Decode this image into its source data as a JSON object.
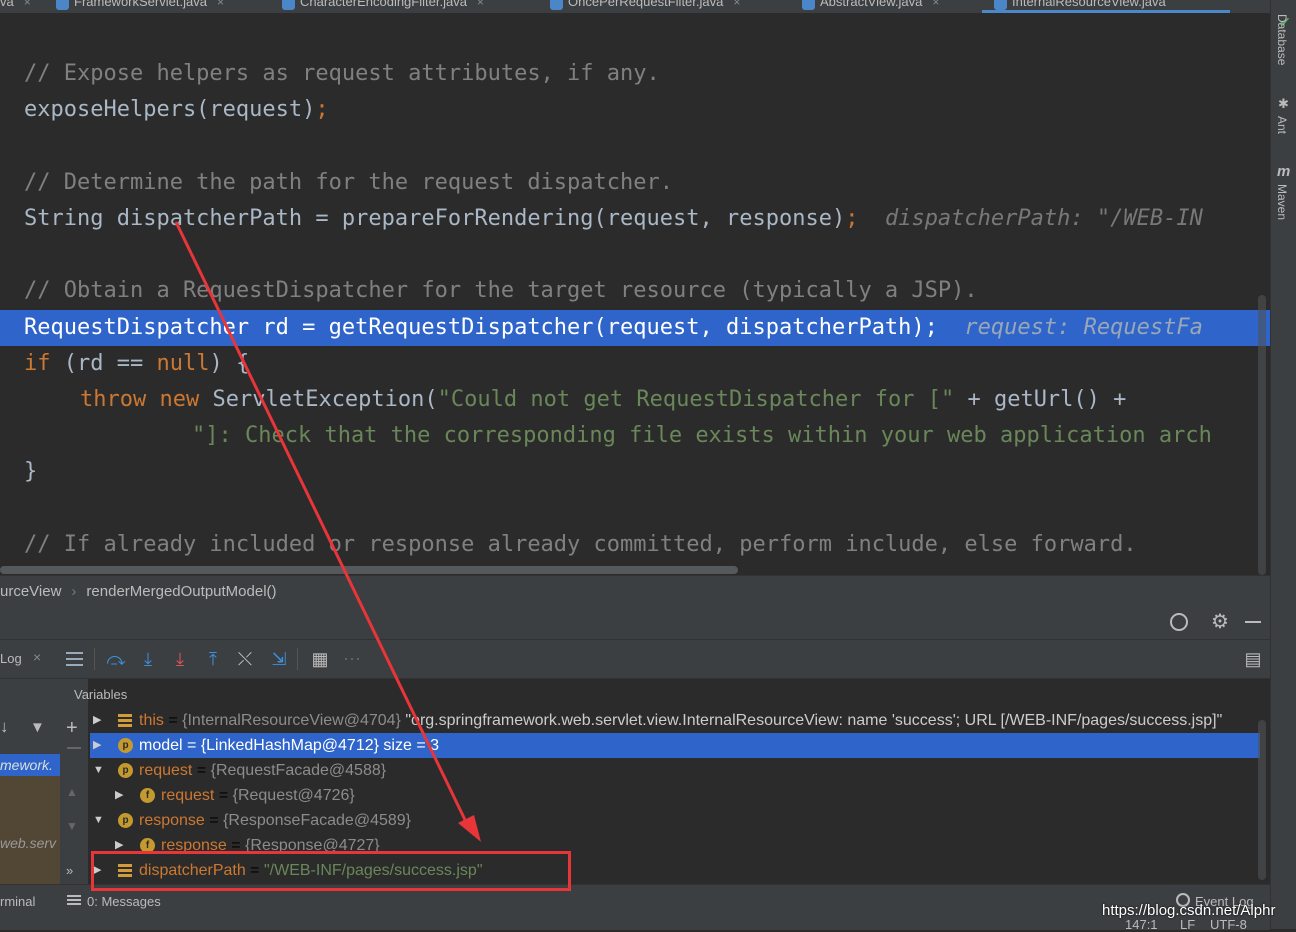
{
  "tabs": [
    {
      "label": "va"
    },
    {
      "label": "FrameworkServlet.java"
    },
    {
      "label": "CharacterEncodingFilter.java"
    },
    {
      "label": "OncePerRequestFilter.java"
    },
    {
      "label": "AbstractView.java"
    },
    {
      "label": "InternalResourceView.java",
      "active": true
    }
  ],
  "right_tools": [
    {
      "label": "Database",
      "icon": "database-icon"
    },
    {
      "label": "Ant",
      "icon": "ant-icon"
    },
    {
      "label": "Maven",
      "icon": "maven-icon"
    }
  ],
  "editor": {
    "line1_comment": "// Expose helpers as request attributes, if any.",
    "line2_call": "exposeHelpers(request)",
    "line2_semi": ";",
    "line4_comment": "// Determine the path for the request dispatcher.",
    "line5_code": "String dispatcherPath = prepareForRendering(request, response)",
    "line5_semi": ";",
    "line5_hint": "dispatcherPath: \"/WEB-IN",
    "line7_comment": "// Obtain a RequestDispatcher for the target resource (typically a JSP).",
    "line8_code": "RequestDispatcher rd = getRequestDispatcher(request, dispatcherPath);",
    "line8_hint": "request: RequestFa",
    "line9_if": "if",
    "line9_rest": " (rd == ",
    "line9_null": "null",
    "line9_end": ") {",
    "line10_throw": "throw",
    "line10_new": "new",
    "line10_cls": "ServletException(",
    "line10_str": "\"Could not get RequestDispatcher for [\"",
    "line10_tail": " + getUrl() +",
    "line11_str": "\"]: Check that the corresponding file exists within your web application arch",
    "line12_close": "}",
    "line14_comment": "// If already included or response already committed, perform include, else forward."
  },
  "breadcrumb": {
    "class": "urceView",
    "method": "renderMergedOutputModel()"
  },
  "debug": {
    "left_tab": "Log",
    "variables_title": "Variables",
    "frames": [
      "mework.",
      "web.serv"
    ],
    "variables": [
      {
        "name": "this",
        "value": "{InternalResourceView@4704}",
        "extra": "\"org.springframework.web.servlet.view.InternalResourceView: name 'success'; URL [/WEB-INF/pages/success.jsp]\"",
        "kind": "lines",
        "expanded": false,
        "depth": 0
      },
      {
        "name": "model",
        "value": "{LinkedHashMap@4712}",
        "extra": "size = 3",
        "kind": "p",
        "expanded": false,
        "depth": 0,
        "selected": true
      },
      {
        "name": "request",
        "value": "{RequestFacade@4588}",
        "extra": "",
        "kind": "p",
        "expanded": true,
        "depth": 0
      },
      {
        "name": "request",
        "value": "{Request@4726}",
        "extra": "",
        "kind": "f",
        "expanded": false,
        "depth": 1
      },
      {
        "name": "response",
        "value": "{ResponseFacade@4589}",
        "extra": "",
        "kind": "p",
        "expanded": true,
        "depth": 0
      },
      {
        "name": "response",
        "value": "{Response@4727}",
        "extra": "",
        "kind": "f",
        "expanded": false,
        "depth": 1
      },
      {
        "name": "dispatcherPath",
        "value": "\"/WEB-INF/pages/success.jsp\"",
        "extra": "",
        "kind": "lines",
        "expanded": false,
        "depth": 0,
        "string": true
      }
    ]
  },
  "status": {
    "terminal": "rminal",
    "messages": "0: Messages",
    "event_log": "Event Log",
    "position": "147:1",
    "line_sep": "LF",
    "encoding": "UTF-8"
  },
  "watermark": "https://blog.csdn.net/Alphr",
  "colors": {
    "selection": "#2f65ca",
    "annotation_red": "#e8353a",
    "keyword": "#cc7832",
    "string": "#6a8759",
    "comment": "#808080"
  }
}
